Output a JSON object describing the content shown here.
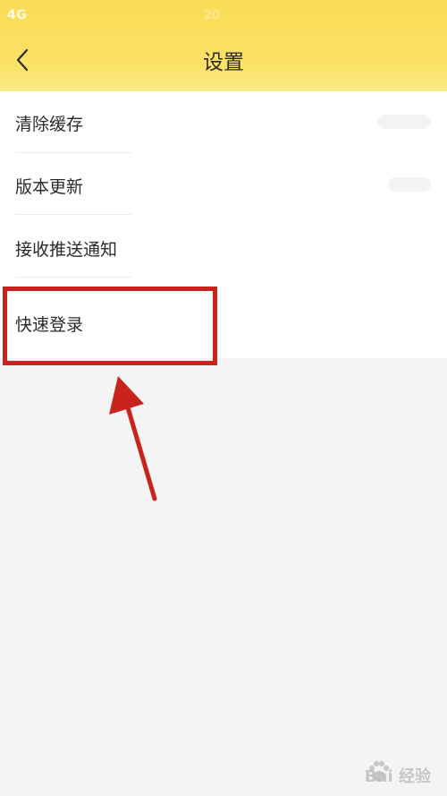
{
  "status_bar": {
    "signal": "4G",
    "time": "20"
  },
  "header": {
    "title": "设置",
    "back_icon": "chevron-left-icon",
    "color": "#f9dc55"
  },
  "settings": {
    "items": [
      {
        "label": "清除缓存"
      },
      {
        "label": "版本更新"
      },
      {
        "label": "接收推送通知"
      },
      {
        "label": "快速登录"
      }
    ]
  },
  "annotation": {
    "highlight_color": "#c9231e",
    "arrow_color": "#c9231e"
  },
  "watermark": {
    "text": "Bai 经验"
  }
}
